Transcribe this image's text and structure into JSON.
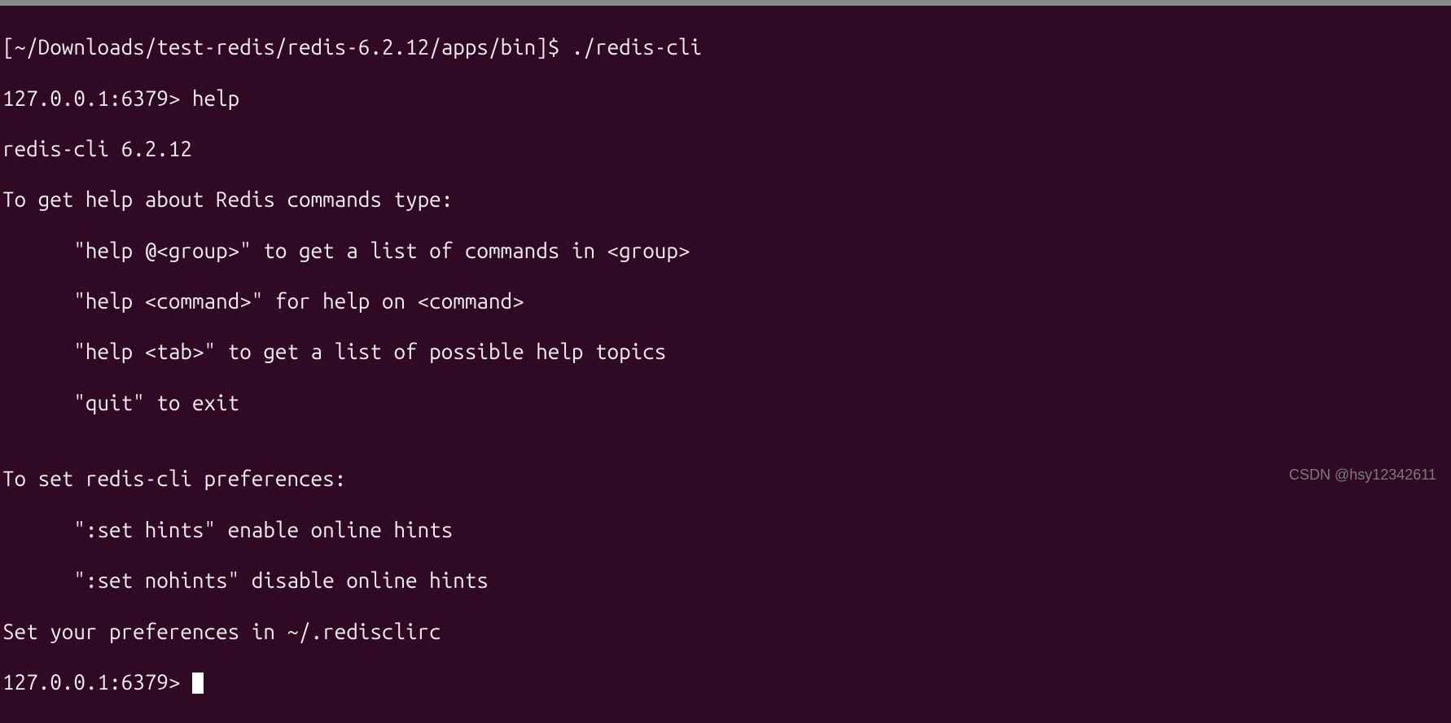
{
  "shell_prompt": "[~/Downloads/test-redis/redis-6.2.12/apps/bin]$ ",
  "shell_command": "./redis-cli",
  "redis_prompt": "127.0.0.1:6379> ",
  "redis_command": "help",
  "output": {
    "version_line": "redis-cli 6.2.12",
    "help_intro": "To get help about Redis commands type:",
    "help_group": "      \"help @<group>\" to get a list of commands in <group>",
    "help_command": "      \"help <command>\" for help on <command>",
    "help_tab": "      \"help <tab>\" to get a list of possible help topics",
    "quit": "      \"quit\" to exit",
    "blank": "",
    "prefs_intro": "To set redis-cli preferences:",
    "set_hints": "      \":set hints\" enable online hints",
    "set_nohints": "      \":set nohints\" disable online hints",
    "prefs_file": "Set your preferences in ~/.redisclirc"
  },
  "watermark": "CSDN @hsy12342611"
}
